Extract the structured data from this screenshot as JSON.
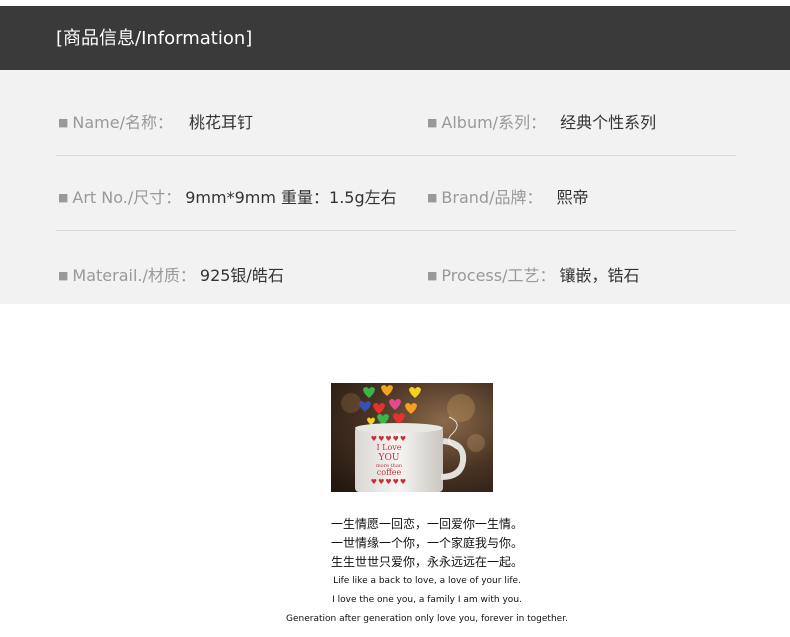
{
  "header": {
    "title": "[商品信息/Information]"
  },
  "info": {
    "rows": [
      {
        "left": {
          "label": "Name/名称：",
          "value": "桃花耳钉"
        },
        "right": {
          "label": "Album/系列：",
          "value": "经典个性系列"
        }
      },
      {
        "left": {
          "label": "Art No./尺寸：",
          "value": "9mm*9mm 重量：1.5g左右"
        },
        "right": {
          "label": "Brand/品牌：",
          "value": "熙帝"
        }
      },
      {
        "left": {
          "label": "Materail./材质：",
          "value": "925银/皓石"
        },
        "right": {
          "label": "Process/工艺：",
          "value": "镶嵌，锆石"
        }
      }
    ]
  },
  "photo": {
    "cup_text": [
      "I Love",
      "YOU",
      "more than",
      "coffee"
    ],
    "colors": {
      "background": "#3b2a20",
      "cup": "#ecebe8",
      "hearts": [
        "#e8312f",
        "#f4a11d",
        "#39b54a",
        "#3a4fb0",
        "#f2d21b",
        "#e64a8c"
      ]
    }
  },
  "poem": {
    "cn_lines": [
      "一生情愿一回恋，一回爱你一生情。",
      "一世情缘一个你，一个家庭我与你。",
      "生生世世只爱你，永永远远在一起。"
    ],
    "en_lines": [
      "Life like a back to love, a love of your life.",
      "I love the one you, a family I am with you.",
      "Generation after generation only love you, forever in together."
    ]
  }
}
